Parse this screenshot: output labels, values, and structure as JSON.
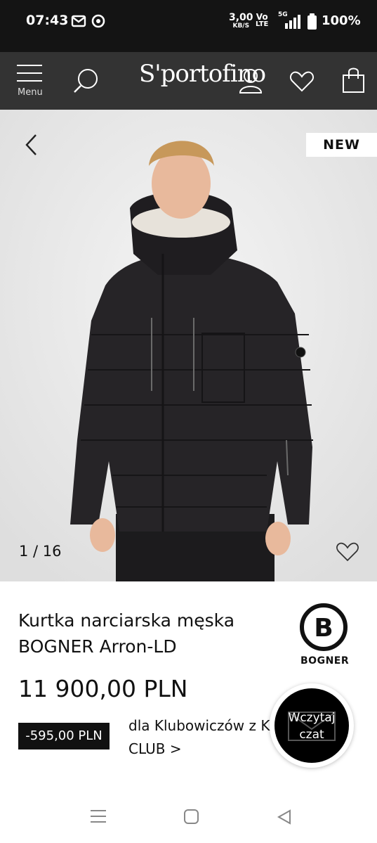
{
  "status_bar": {
    "time": "07:43",
    "network_speed_value": "3,00",
    "network_speed_unit": "KB/S",
    "volte_top": "Vo",
    "volte_bottom": "LTE",
    "signal_label": "5G",
    "battery": "100%",
    "icons": [
      "gmail-icon",
      "chrome-icon",
      "signal-icon",
      "battery-icon"
    ]
  },
  "header": {
    "menu_label": "Menu",
    "logo": "S'portofino",
    "icons": [
      "hamburger-icon",
      "search-icon",
      "account-icon",
      "wishlist-icon",
      "bag-icon"
    ]
  },
  "gallery": {
    "badge": "NEW",
    "counter": "1 / 16",
    "icons": [
      "back-arrow-icon",
      "heart-icon"
    ]
  },
  "product": {
    "title_line1": "Kurtka narciarska męska",
    "title_line2": "BOGNER Arron-LD",
    "brand": "BOGNER",
    "price": "11 900,00 PLN",
    "discount": "-595,00 PLN",
    "club_line1": "dla Klubowiczów z K",
    "club_line2": "CLUB >"
  },
  "chat": {
    "label_line1": "Wczytaj",
    "label_line2": "czat"
  },
  "colors": {
    "status_bar": "#141414",
    "header": "#333333",
    "gallery_bg": "#e9e9e9",
    "badge_dark": "#111111"
  }
}
